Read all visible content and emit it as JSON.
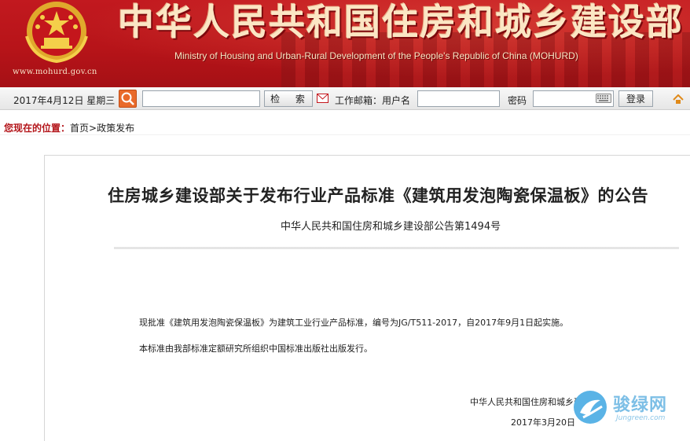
{
  "header": {
    "title_cn": "中华人民共和国住房和城乡建设部",
    "title_en": "Ministry of Housing and Urban-Rural Development of the People's Republic of China (MOHURD)",
    "url": "www.mohurd.gov.cn",
    "emblem_icon": "national-emblem-icon",
    "accent_color": "#b7141a"
  },
  "toolbar": {
    "date": "2017年4月12日  星期三",
    "search_placeholder": "",
    "search_button": "检 索",
    "mail_label": "工作邮箱：用户名",
    "username_value": "",
    "password_label": "密码",
    "password_value": "",
    "login_button": "登录"
  },
  "breadcrumb": {
    "lead": "您现在的位置：",
    "home": "首页",
    "separator": ">",
    "current": "政策发布"
  },
  "article": {
    "title": "住房城乡建设部关于发布行业产品标准《建筑用发泡陶瓷保温板》的公告",
    "subtitle": "中华人民共和国住房和城乡建设部公告第1494号",
    "paragraphs": [
      "现批准《建筑用发泡陶瓷保温板》为建筑工业行业产品标准，编号为JG/T511-2017，自2017年9月1日起实施。",
      "本标准由我部标准定额研究所组织中国标准出版社出版发行。"
    ],
    "signature_org": "中华人民共和国住房和城乡建设部",
    "signature_date": "2017年3月20日"
  },
  "watermark": {
    "text": "骏绿网",
    "sub": "Jungreen.com"
  }
}
